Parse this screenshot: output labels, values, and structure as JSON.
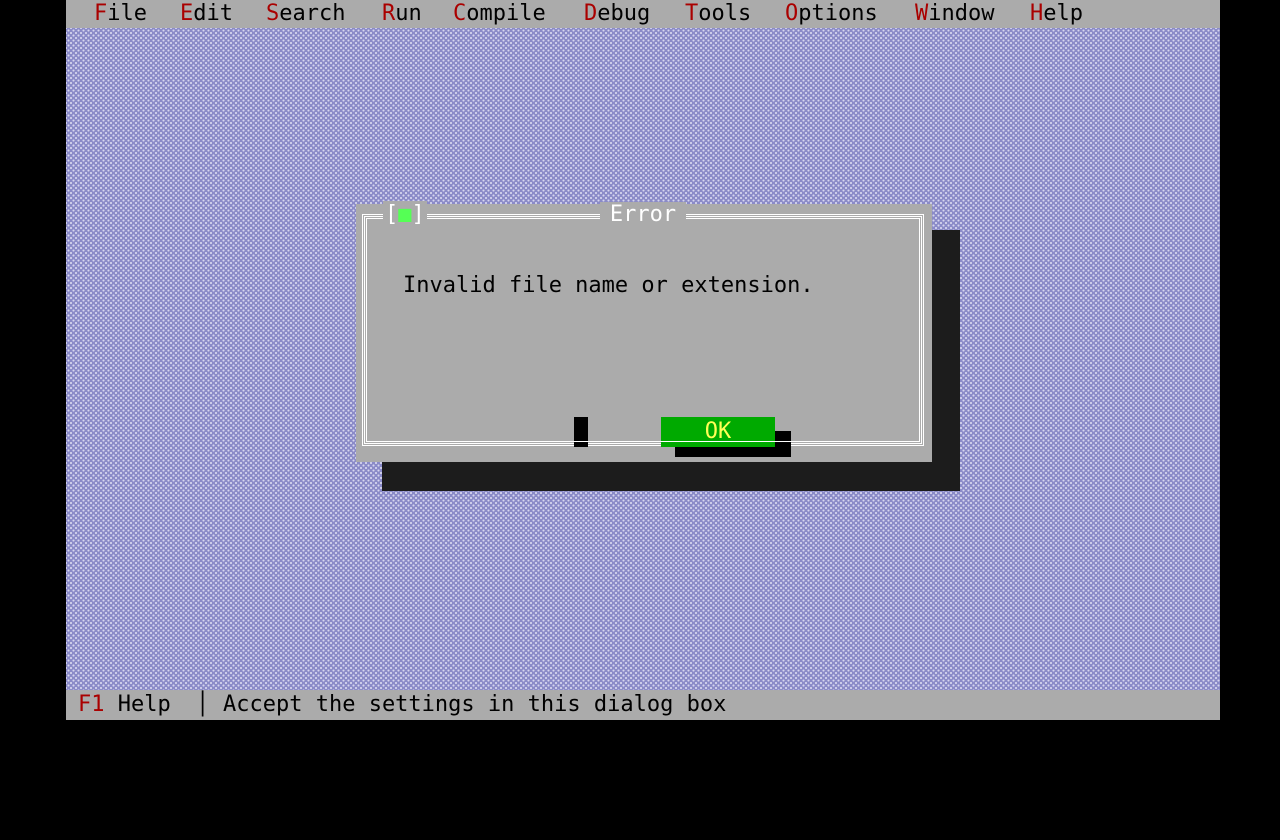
{
  "menubar": {
    "items": [
      {
        "hot": "F",
        "rest": "ile"
      },
      {
        "hot": "E",
        "rest": "dit"
      },
      {
        "hot": "S",
        "rest": "earch"
      },
      {
        "hot": "R",
        "rest": "un"
      },
      {
        "hot": "C",
        "rest": "ompile"
      },
      {
        "hot": "D",
        "rest": "ebug"
      },
      {
        "hot": "T",
        "rest": "ools"
      },
      {
        "hot": "O",
        "rest": "ptions"
      },
      {
        "hot": "W",
        "rest": "indow"
      },
      {
        "hot": "H",
        "rest": "elp"
      }
    ]
  },
  "dialog": {
    "title": "Error",
    "close_left": "[",
    "close_glyph": "■",
    "close_right": "]",
    "message": "Invalid file name or extension.",
    "ok_label": "OK"
  },
  "statusbar": {
    "key": "F1",
    "key_label": " Help",
    "separator": "│",
    "hint": "Accept the settings in this dialog box"
  },
  "colors": {
    "desktop": "#8a8ac8",
    "chrome": "#ababab",
    "hotkey": "#aa0000",
    "button": "#00aa00",
    "button_text": "#ffff55"
  }
}
